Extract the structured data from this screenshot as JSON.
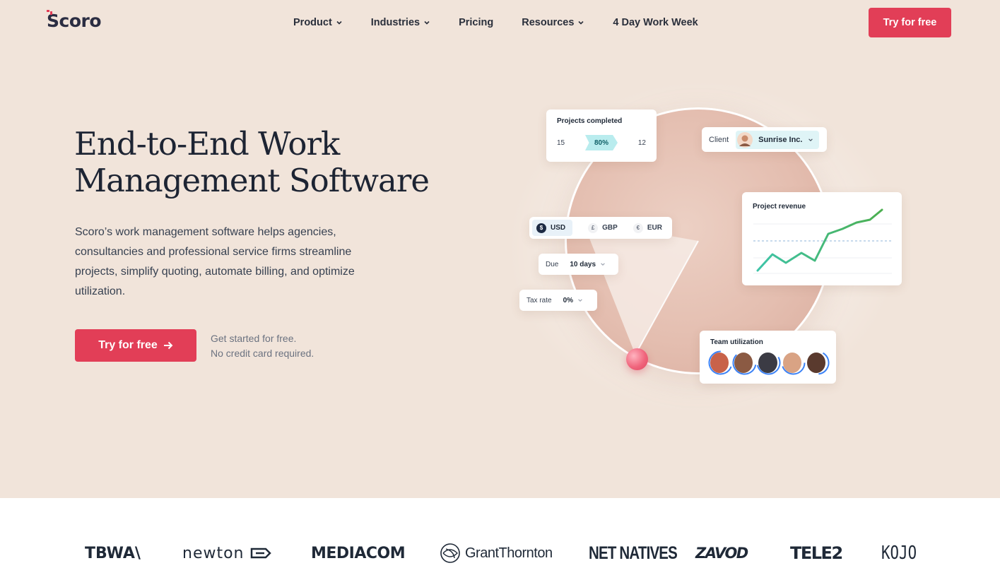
{
  "brand": {
    "name": "Scoro",
    "accent": "#e23e57",
    "hero_bg": "#f1e4da"
  },
  "nav": {
    "items": [
      {
        "label": "Product",
        "dropdown": true
      },
      {
        "label": "Industries",
        "dropdown": true
      },
      {
        "label": "Pricing",
        "dropdown": false
      },
      {
        "label": "Resources",
        "dropdown": true
      },
      {
        "label": "4 Day Work Week",
        "dropdown": false
      }
    ],
    "cta_label": "Try for free"
  },
  "hero": {
    "headline_line1": "End-to-End Work",
    "headline_line2": "Management Software",
    "description": "Scoro’s work management software helps agencies, consultancies and professional service firms streamline projects, simplify quoting, automate billing, and optimize utilization.",
    "cta_label": "Try for free",
    "note_line1": "Get started for free.",
    "note_line2": "No credit card required."
  },
  "illustration": {
    "projects_card": {
      "title": "Projects completed",
      "left_value": "15",
      "percent": "80%",
      "right_value": "12"
    },
    "client_card": {
      "label": "Client",
      "value": "Sunrise Inc."
    },
    "currency_card": {
      "options": [
        {
          "symbol": "$",
          "code": "USD",
          "selected": true
        },
        {
          "symbol": "£",
          "code": "GBP",
          "selected": false
        },
        {
          "symbol": "€",
          "code": "EUR",
          "selected": false
        }
      ]
    },
    "due_card": {
      "label": "Due",
      "value": "10 days"
    },
    "tax_card": {
      "label": "Tax rate",
      "value": "0%"
    },
    "revenue_card": {
      "title": "Project revenue",
      "line_color_start": "#3ec4a8",
      "line_color_end": "#4caf50"
    },
    "team_card": {
      "title": "Team utilization",
      "member_count": 5,
      "ring_color": "#3b82f6"
    }
  },
  "logos": {
    "items": [
      {
        "name": "TBWA\\"
      },
      {
        "name": "newton"
      },
      {
        "name": "MEDIACOM"
      },
      {
        "name": "GrantThornton"
      },
      {
        "name": "NET NATIVES"
      },
      {
        "name": "ZAVOD"
      },
      {
        "name": "TELE2"
      },
      {
        "name": "KOJO"
      }
    ]
  }
}
